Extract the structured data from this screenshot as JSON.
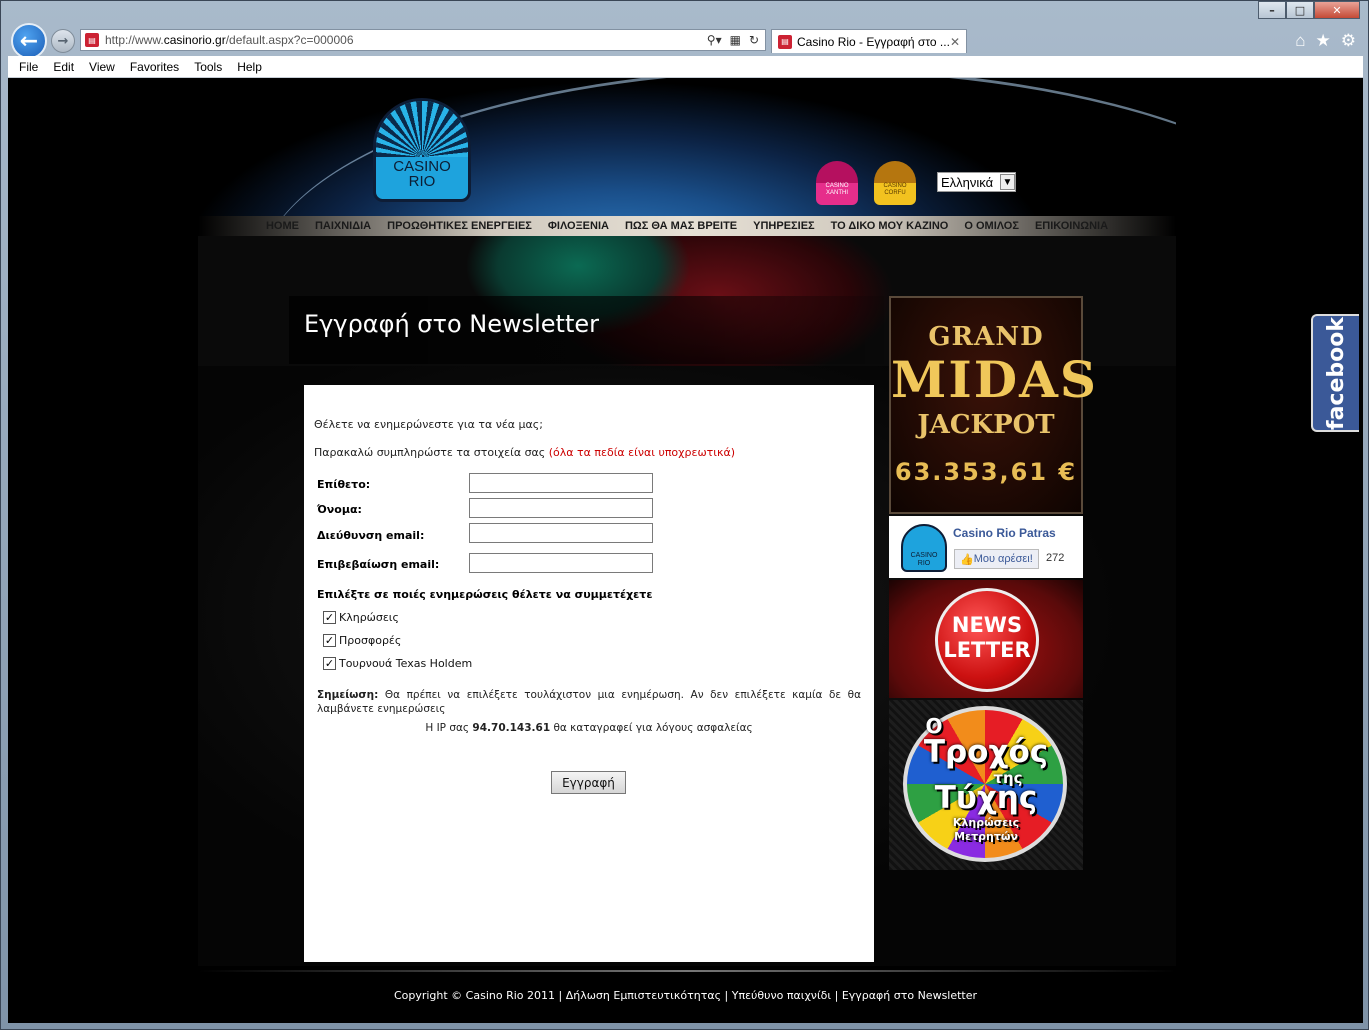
{
  "browser": {
    "url_prefix": "http://www.",
    "url_domain": "casinorio.gr",
    "url_path": "/default.aspx?c=000006",
    "tab_title": "Casino Rio - Εγγραφή στο ...",
    "menu": [
      "File",
      "Edit",
      "View",
      "Favorites",
      "Tools",
      "Help"
    ]
  },
  "site": {
    "logo_text": "CASINO\nRIO",
    "sub_logos": [
      "CASINO\nXANTHI",
      "CASINO\nCORFU"
    ],
    "language": "Ελληνικά",
    "nav": [
      "HOME",
      "ΠΑΙΧΝΙΔΙΑ",
      "ΠΡΟΩΘΗΤΙΚΕΣ ΕΝΕΡΓΕΙΕΣ",
      "ΦΙΛΟΞΕΝΙΑ",
      "ΠΩΣ ΘΑ ΜΑΣ ΒΡΕΙΤΕ",
      "ΥΠΗΡΕΣΙΕΣ",
      "ΤΟ ΔΙΚΟ ΜΟΥ ΚΑΖΙΝΟ",
      "Ο ΟΜΙΛΟΣ",
      "ΕΠΙΚΟΙΝΩΝΙΑ"
    ]
  },
  "page": {
    "title": "Εγγραφή στο Newsletter",
    "question": "Θέλετε να ενημερώνεστε για τα νέα μας;",
    "instructions": "Παρακαλώ συμπληρώστε τα στοιχεία σας ",
    "required_note": "(όλα τα πεδία είναι υποχρεωτικά)",
    "fields": [
      {
        "label": "Επίθετο:",
        "value": ""
      },
      {
        "label": "Όνομα:",
        "value": ""
      },
      {
        "label": "Διεύθυνση email:",
        "value": ""
      },
      {
        "label": "Επιβεβαίωση email:",
        "value": ""
      }
    ],
    "choose_label": "Επιλέξτε σε ποιές ενημερώσεις θέλετε να συμμετέχετε",
    "checkboxes": [
      {
        "label": "Κληρώσεις",
        "checked": true
      },
      {
        "label": "Προσφορές",
        "checked": true
      },
      {
        "label": "Τουρνουά Texas Holdem",
        "checked": true
      }
    ],
    "note_label": "Σημείωση:",
    "note_text": " Θα πρέπει να επιλέξετε τουλάχιστον μια ενημέρωση. Αν δεν επιλέξετε καμία δε θα λαμβάνετε ενημερώσεις",
    "ip_prefix": "Η IP σας ",
    "ip": "94.70.143.61",
    "ip_suffix": " θα καταγραφεί για λόγους ασφαλείας",
    "submit_label": "Εγγραφή"
  },
  "sidebar": {
    "jackpot_line1": "GRAND",
    "jackpot_line2": "MIDAS",
    "jackpot_line3": "JACKPOT",
    "jackpot_amount": "63.353,61 €",
    "fb_name": "Casino Rio Patras",
    "fb_like": "Μου αρέσει!",
    "fb_count": "272",
    "fb_avatar_text": "CASINO\nRIO",
    "newsletter_badge": "NEWS\nLETTER",
    "wheel_o": "Ο",
    "wheel_trochos": "Τροχός",
    "wheel_tis": "της",
    "wheel_tyxis": "Τύχης",
    "wheel_sub1": "Κληρώσεις",
    "wheel_sub2": "Μετρητών"
  },
  "footer": "Copyright © Casino Rio 2011 | Δήλωση Εμπιστευτικότητας | Υπεύθυνο παιχνίδι | Εγγραφή στο Newsletter",
  "facebook_tab": "facebook"
}
